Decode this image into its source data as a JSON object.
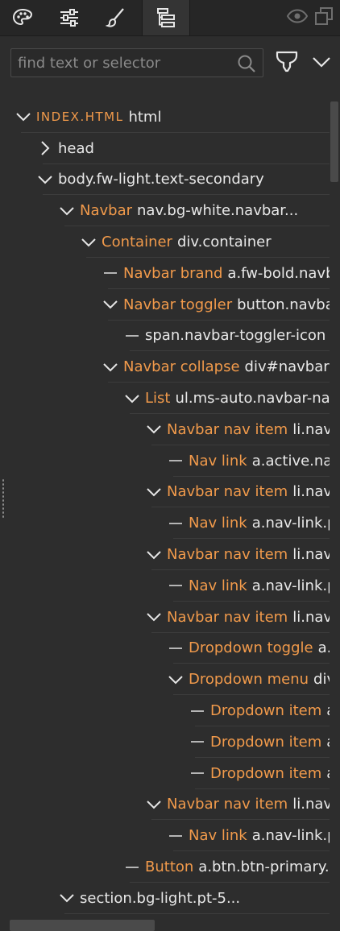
{
  "toolbar": {
    "tools": [
      {
        "icon": "palette-icon"
      },
      {
        "icon": "sliders-icon"
      },
      {
        "icon": "brush-icon"
      },
      {
        "icon": "layers-tree-icon",
        "active": true
      }
    ],
    "right_icons": [
      "eye-icon",
      "duplicate-icon"
    ]
  },
  "search": {
    "placeholder": "find text or selector",
    "value": ""
  },
  "colors": {
    "accent": "#f19a4b",
    "text": "#e6e6e6",
    "bg": "#2d2d2d",
    "toolbar_bg": "#262626"
  },
  "tree": [
    {
      "depth": 0,
      "toggle": "open",
      "name": "INDEX.HTML",
      "selector": "html",
      "root": true
    },
    {
      "depth": 1,
      "toggle": "closed",
      "name": "",
      "selector": "head"
    },
    {
      "depth": 1,
      "toggle": "open",
      "name": "",
      "selector": "body.fw-light.text-secondary"
    },
    {
      "depth": 2,
      "toggle": "open",
      "name": "Navbar",
      "selector": "nav.bg-white.navbar..."
    },
    {
      "depth": 3,
      "toggle": "open",
      "name": "Container",
      "selector": "div.container"
    },
    {
      "depth": 4,
      "toggle": "leaf",
      "name": "Navbar brand",
      "selector": "a.fw-bold.navb"
    },
    {
      "depth": 4,
      "toggle": "open",
      "name": "Navbar toggler",
      "selector": "button.navba"
    },
    {
      "depth": 5,
      "toggle": "leaf",
      "name": "",
      "selector": "span.navbar-toggler-icon"
    },
    {
      "depth": 4,
      "toggle": "open",
      "name": "Navbar collapse",
      "selector": "div#navbarN"
    },
    {
      "depth": 5,
      "toggle": "open",
      "name": "List",
      "selector": "ul.ms-auto.navbar-na"
    },
    {
      "depth": 6,
      "toggle": "open",
      "name": "Navbar nav item",
      "selector": "li.nav-"
    },
    {
      "depth": 7,
      "toggle": "leaf",
      "name": "Nav link",
      "selector": "a.active.nav"
    },
    {
      "depth": 6,
      "toggle": "open",
      "name": "Navbar nav item",
      "selector": "li.nav-"
    },
    {
      "depth": 7,
      "toggle": "leaf",
      "name": "Nav link",
      "selector": "a.nav-link.p"
    },
    {
      "depth": 6,
      "toggle": "open",
      "name": "Navbar nav item",
      "selector": "li.nav-"
    },
    {
      "depth": 7,
      "toggle": "leaf",
      "name": "Nav link",
      "selector": "a.nav-link.p"
    },
    {
      "depth": 6,
      "toggle": "open",
      "name": "Navbar nav item",
      "selector": "li.nav-"
    },
    {
      "depth": 7,
      "toggle": "leaf",
      "name": "Dropdown toggle",
      "selector": "a."
    },
    {
      "depth": 7,
      "toggle": "open",
      "name": "Dropdown menu",
      "selector": "div"
    },
    {
      "depth": 8,
      "toggle": "leaf",
      "name": "Dropdown item",
      "selector": "a"
    },
    {
      "depth": 8,
      "toggle": "leaf",
      "name": "Dropdown item",
      "selector": "a"
    },
    {
      "depth": 8,
      "toggle": "leaf",
      "name": "Dropdown item",
      "selector": "a"
    },
    {
      "depth": 6,
      "toggle": "open",
      "name": "Navbar nav item",
      "selector": "li.nav-"
    },
    {
      "depth": 7,
      "toggle": "leaf",
      "name": "Nav link",
      "selector": "a.nav-link.p"
    },
    {
      "depth": 5,
      "toggle": "leaf",
      "name": "Button",
      "selector": "a.btn.btn-primary."
    },
    {
      "depth": 2,
      "toggle": "open",
      "name": "",
      "selector": "section.bg-light.pt-5..."
    }
  ]
}
